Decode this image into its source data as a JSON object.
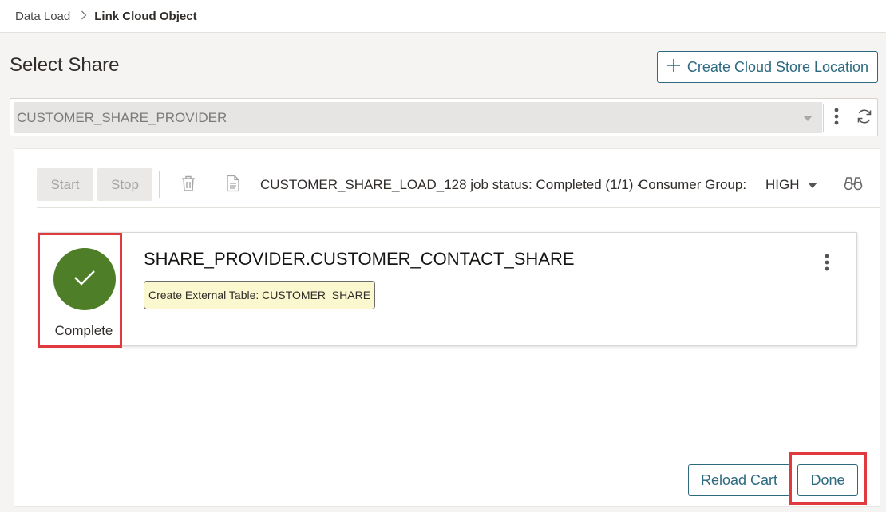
{
  "breadcrumb": {
    "parent": "Data Load",
    "separator": ">",
    "current": "Link Cloud Object"
  },
  "page": {
    "title": "Select Share",
    "create_button_label": "Create Cloud Store Location"
  },
  "share_select": {
    "value": "CUSTOMER_SHARE_PROVIDER"
  },
  "toolbar": {
    "start_label": "Start",
    "stop_label": "Stop",
    "job_status": "CUSTOMER_SHARE_LOAD_128 job status: Completed (1/1) -",
    "consumer_group_label": "Consumer Group:",
    "consumer_group_value": "HIGH"
  },
  "job_card": {
    "status": "Complete",
    "title": "SHARE_PROVIDER.CUSTOMER_CONTACT_SHARE",
    "tag": "Create External Table: CUSTOMER_SHARE"
  },
  "footer": {
    "reload_label": "Reload Cart",
    "done_label": "Done"
  },
  "colors": {
    "accent": "#2d6a80",
    "success": "#4e7e27",
    "highlight": "#e0393e",
    "tag_background": "#fbf7cf"
  },
  "icons": [
    "chevron-right-icon",
    "plus-icon",
    "caret-down-icon",
    "kebab-icon",
    "refresh-icon",
    "trash-icon",
    "document-icon",
    "binoculars-icon",
    "checkmark-icon"
  ]
}
